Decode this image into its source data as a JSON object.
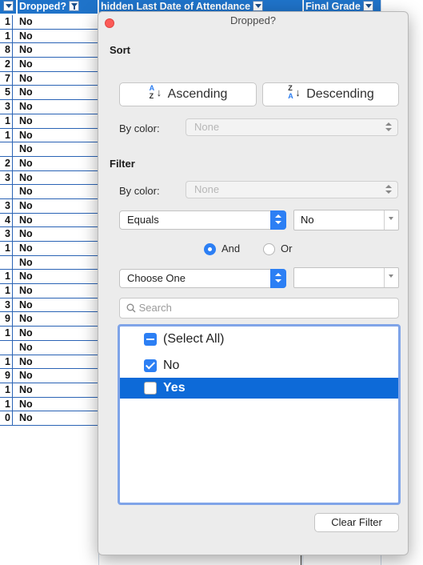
{
  "sheet": {
    "headers": {
      "dropped": "Dropped?",
      "hidden_last_date": "hidden Last Date of Attendance",
      "final_grade": "Final Grade"
    },
    "rows": [
      {
        "a": "1",
        "b": "No"
      },
      {
        "a": "1",
        "b": "No"
      },
      {
        "a": "8",
        "b": "No"
      },
      {
        "a": "2",
        "b": "No"
      },
      {
        "a": "7",
        "b": "No"
      },
      {
        "a": "5",
        "b": "No"
      },
      {
        "a": "3",
        "b": "No"
      },
      {
        "a": "1",
        "b": "No"
      },
      {
        "a": "1",
        "b": "No"
      },
      {
        "a": "",
        "b": "No"
      },
      {
        "a": "2",
        "b": "No"
      },
      {
        "a": "3",
        "b": "No"
      },
      {
        "a": "",
        "b": "No"
      },
      {
        "a": "3",
        "b": "No"
      },
      {
        "a": "4",
        "b": "No"
      },
      {
        "a": "3",
        "b": "No"
      },
      {
        "a": "1",
        "b": "No"
      },
      {
        "a": "",
        "b": "No"
      },
      {
        "a": "1",
        "b": "No"
      },
      {
        "a": "1",
        "b": "No"
      },
      {
        "a": "3",
        "b": "No"
      },
      {
        "a": "9",
        "b": "No"
      },
      {
        "a": "1",
        "b": "No"
      },
      {
        "a": "",
        "b": "No"
      },
      {
        "a": "1",
        "b": "No"
      },
      {
        "a": "9",
        "b": "No"
      },
      {
        "a": "1",
        "b": "No"
      },
      {
        "a": "1",
        "b": "No"
      },
      {
        "a": "0",
        "b": "No"
      }
    ]
  },
  "popup": {
    "title": "Dropped?",
    "sort": {
      "section_label": "Sort",
      "ascending_label": "Ascending",
      "descending_label": "Descending",
      "by_color_label": "By color:",
      "by_color_value": "None"
    },
    "filter": {
      "section_label": "Filter",
      "by_color_label": "By color:",
      "by_color_value": "None",
      "condition1_operator": "Equals",
      "condition1_value": "No",
      "and_label": "And",
      "or_label": "Or",
      "logic_selected": "And",
      "condition2_operator": "Choose One",
      "condition2_value": "",
      "search_placeholder": "Search",
      "items": [
        {
          "label": "(Select All)",
          "state": "mixed"
        },
        {
          "label": "No",
          "state": "checked"
        },
        {
          "label": "Yes",
          "state": "unchecked",
          "highlighted": true
        }
      ],
      "clear_label": "Clear Filter"
    }
  },
  "colors": {
    "header_blue": "#1f73c9",
    "accent_blue": "#2c7ff4",
    "selection_blue": "#0d6ad8",
    "close_red": "#fc5b57"
  }
}
